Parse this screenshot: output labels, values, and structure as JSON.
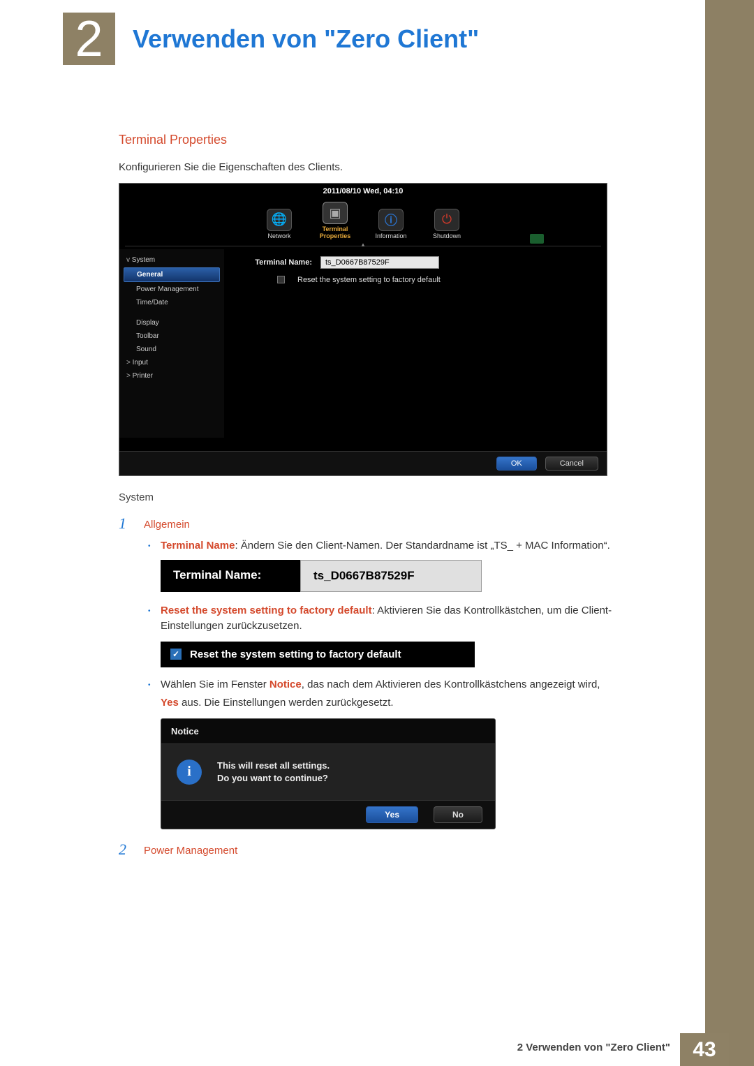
{
  "chapter": {
    "num": "2",
    "title": "Verwenden von \"Zero Client\""
  },
  "section": {
    "title": "Terminal Properties",
    "desc": "Konfigurieren Sie die Eigenschaften des Clients."
  },
  "shot1": {
    "datetime": "2011/08/10 Wed, 04:10",
    "toolbar": [
      {
        "label": "Network",
        "glyph": "🌐"
      },
      {
        "label": "Terminal Properties",
        "glyph": "▣"
      },
      {
        "label": "Information",
        "glyph": "ⓘ"
      },
      {
        "label": "Shutdown",
        "glyph": "⏻"
      }
    ],
    "sidebar": {
      "system": "System",
      "general": "General",
      "pm": "Power Management",
      "td": "Time/Date",
      "display": "Display",
      "toolbar": "Toolbar",
      "sound": "Sound",
      "input": "Input",
      "printer": "Printer"
    },
    "form": {
      "tn_label": "Terminal Name:",
      "tn_value": "ts_D0667B87529F",
      "reset_label": "Reset the system setting to factory default"
    },
    "ok": "OK",
    "cancel": "Cancel"
  },
  "after": {
    "system_hdr": "System",
    "item1": {
      "num": "1",
      "label": "Allgemein",
      "bullet1": {
        "strong": "Terminal Name",
        "rest": ": Ändern Sie den Client-Namen. Der Standardname ist „TS_ + MAC Information“."
      },
      "shot2": {
        "label": "Terminal Name:",
        "value": "ts_D0667B87529F"
      },
      "bullet2": {
        "strong": "Reset the system setting to factory default",
        "rest": ": Aktivieren Sie das Kontrollkästchen, um die Client-Einstellungen zurückzusetzen."
      },
      "shot3": {
        "label": "Reset the system setting to factory default"
      },
      "bullet3": {
        "pre": "Wählen Sie im Fenster ",
        "notice": "Notice",
        "mid": ", das nach dem Aktivieren des Kontrollkästchens angezeigt wird, ",
        "yes": "Yes",
        "post": " aus. Die Einstellungen werden zurückgesetzt."
      },
      "shot4": {
        "title": "Notice",
        "line1": "This will reset all settings.",
        "line2": "Do you want to continue?",
        "yes": "Yes",
        "no": "No"
      }
    },
    "item2": {
      "num": "2",
      "label": "Power Management"
    }
  },
  "footer": {
    "text": "2 Verwenden von \"Zero Client\"",
    "page": "43"
  }
}
